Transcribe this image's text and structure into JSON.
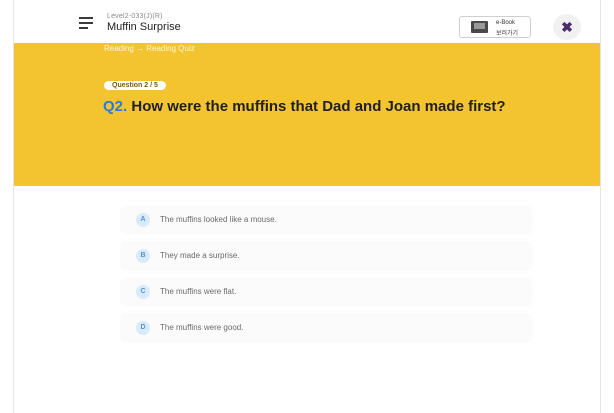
{
  "header": {
    "level_code": "Level2-033(J)(R)",
    "book_title": "Muffin Surprise",
    "ebook": {
      "line1": "e-Book",
      "line2": "보러가기"
    },
    "close_glyph": "✖"
  },
  "breadcrumb": "Reading → Reading Quiz",
  "question": {
    "badge": "Question 2 / 5",
    "number": "Q2.",
    "text": "How were the muffins that Dad and Joan made first?"
  },
  "options": [
    {
      "letter": "A",
      "text": "The muffins looked like a mouse."
    },
    {
      "letter": "B",
      "text": "They made a surprise."
    },
    {
      "letter": "C",
      "text": "The muffins were flat."
    },
    {
      "letter": "D",
      "text": "The muffins were good."
    }
  ],
  "colors": {
    "banner": "#f4c430",
    "question_number": "#2a7bd8",
    "option_badge_bg": "#d9ebfa"
  }
}
